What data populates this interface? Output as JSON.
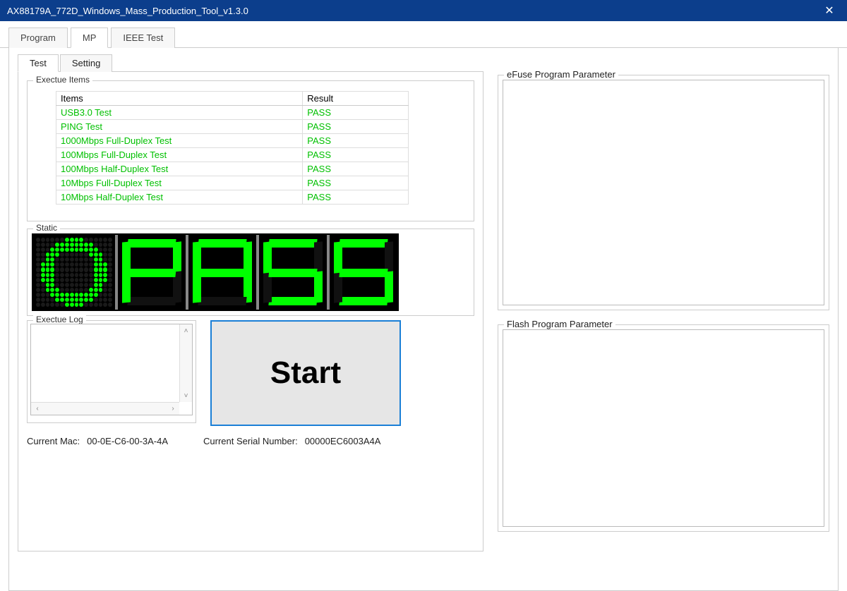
{
  "window": {
    "title": "AX88179A_772D_Windows_Mass_Production_Tool_v1.3.0"
  },
  "outer_tabs": {
    "program": "Program",
    "mp": "MP",
    "ieee": "IEEE Test",
    "active": "mp"
  },
  "inner_tabs": {
    "test": "Test",
    "setting": "Setting",
    "active": "test"
  },
  "execute_items": {
    "legend": "Exectue Items",
    "headers": {
      "item": "Items",
      "result": "Result"
    },
    "rows": [
      {
        "item": "USB3.0 Test",
        "result": "PASS"
      },
      {
        "item": "PING Test",
        "result": "PASS"
      },
      {
        "item": "1000Mbps Full-Duplex Test",
        "result": "PASS"
      },
      {
        "item": "100Mbps Full-Duplex Test",
        "result": "PASS"
      },
      {
        "item": "100Mbps Half-Duplex Test",
        "result": "PASS"
      },
      {
        "item": "10Mbps Full-Duplex Test",
        "result": "PASS"
      },
      {
        "item": "10Mbps Half-Duplex Test",
        "result": "PASS"
      }
    ]
  },
  "static": {
    "legend": "Static",
    "display_text": "PASS"
  },
  "execute_log": {
    "legend": "Exectue Log",
    "content": ""
  },
  "start_label": "Start",
  "current_mac": {
    "label": "Current Mac:",
    "value": "00-0E-C6-00-3A-4A"
  },
  "current_serial": {
    "label": "Current Serial Number:",
    "value": "00000EC6003A4A"
  },
  "efuse": {
    "legend": "eFuse Program Parameter",
    "content": ""
  },
  "flash": {
    "legend": "Flash Program Parameter",
    "content": ""
  }
}
